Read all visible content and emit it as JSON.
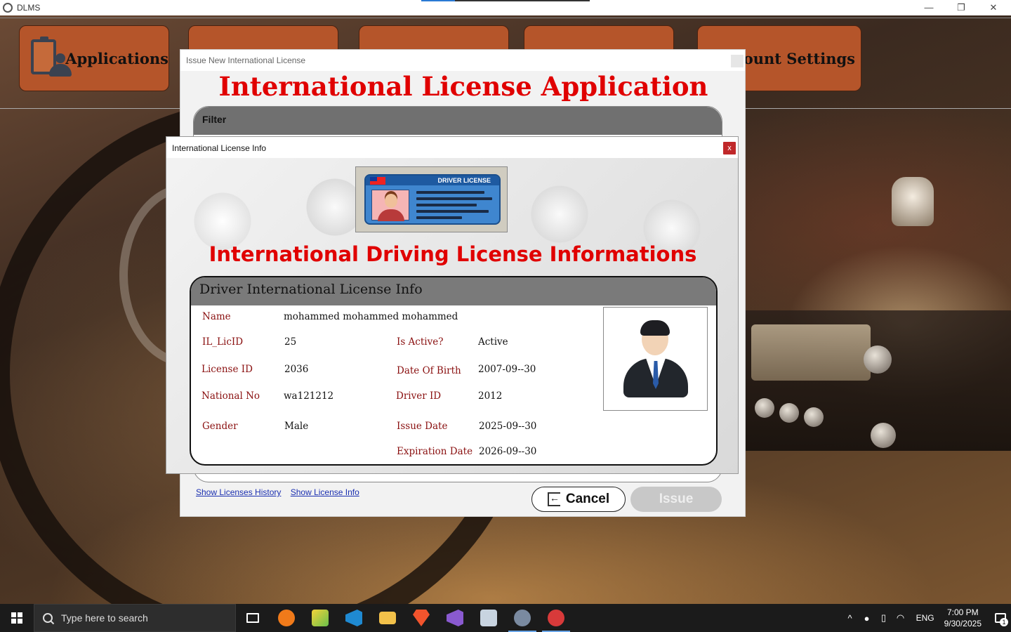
{
  "window": {
    "title": "DLMS",
    "minimize_glyph": "—",
    "restore_glyph": "❐",
    "close_glyph": "✕"
  },
  "menu": {
    "items": [
      {
        "label": "Applications",
        "icon": "clipboard-user-icon"
      },
      {
        "label": "",
        "icon": "people-icon"
      },
      {
        "label": "",
        "icon": "driver-icon"
      },
      {
        "label": "",
        "icon": "user-icon"
      },
      {
        "label": "Account Settings",
        "icon": "gear-icon"
      }
    ],
    "button_color": "#b5552a"
  },
  "issue_window": {
    "caption": "Issue New International License",
    "title": "International License Application",
    "filter_label": "Filter",
    "links": {
      "licenses_history": "Show Licenses History",
      "license_info": "Show License Info"
    },
    "cancel_label": "Cancel",
    "issue_label": "Issue",
    "title_color": "#e00000"
  },
  "info_dialog": {
    "caption": "International License Info",
    "close_glyph": "x",
    "card_banner": "DRIVER LICENSE",
    "heading": "International Driving License Informations",
    "section_title": "Driver International License Info",
    "fields": {
      "name": {
        "label": "Name",
        "value": "mohammed mohammed mohammed"
      },
      "il_licid": {
        "label": "IL_LicID",
        "value": "25"
      },
      "is_active": {
        "label": "Is Active?",
        "value": "Active"
      },
      "license_id": {
        "label": "License ID",
        "value": "2036"
      },
      "date_of_birth": {
        "label": "Date Of Birth",
        "value": "2007-09--30"
      },
      "national_no": {
        "label": "National No",
        "value": "wa121212"
      },
      "driver_id": {
        "label": "Driver ID",
        "value": "2012"
      },
      "gender": {
        "label": "Gender",
        "value": "Male"
      },
      "issue_date": {
        "label": "Issue Date",
        "value": "2025-09--30"
      },
      "expiration_date": {
        "label": "Expiration Date",
        "value": "2026-09--30"
      }
    },
    "label_color": "#8a1010"
  },
  "taskbar": {
    "search_placeholder": "Type here to search",
    "apps": [
      "task-view-icon",
      "app-orange-icon",
      "app-sticky-icon",
      "vscode-icon",
      "file-explorer-icon",
      "brave-icon",
      "visual-studio-icon",
      "app-window-icon",
      "app-dlms-icon",
      "app-tools-icon"
    ],
    "tray": {
      "chevron": "^",
      "language": "ENG",
      "time": "7:00 PM",
      "date": "9/30/2025",
      "notifications": "1"
    }
  }
}
